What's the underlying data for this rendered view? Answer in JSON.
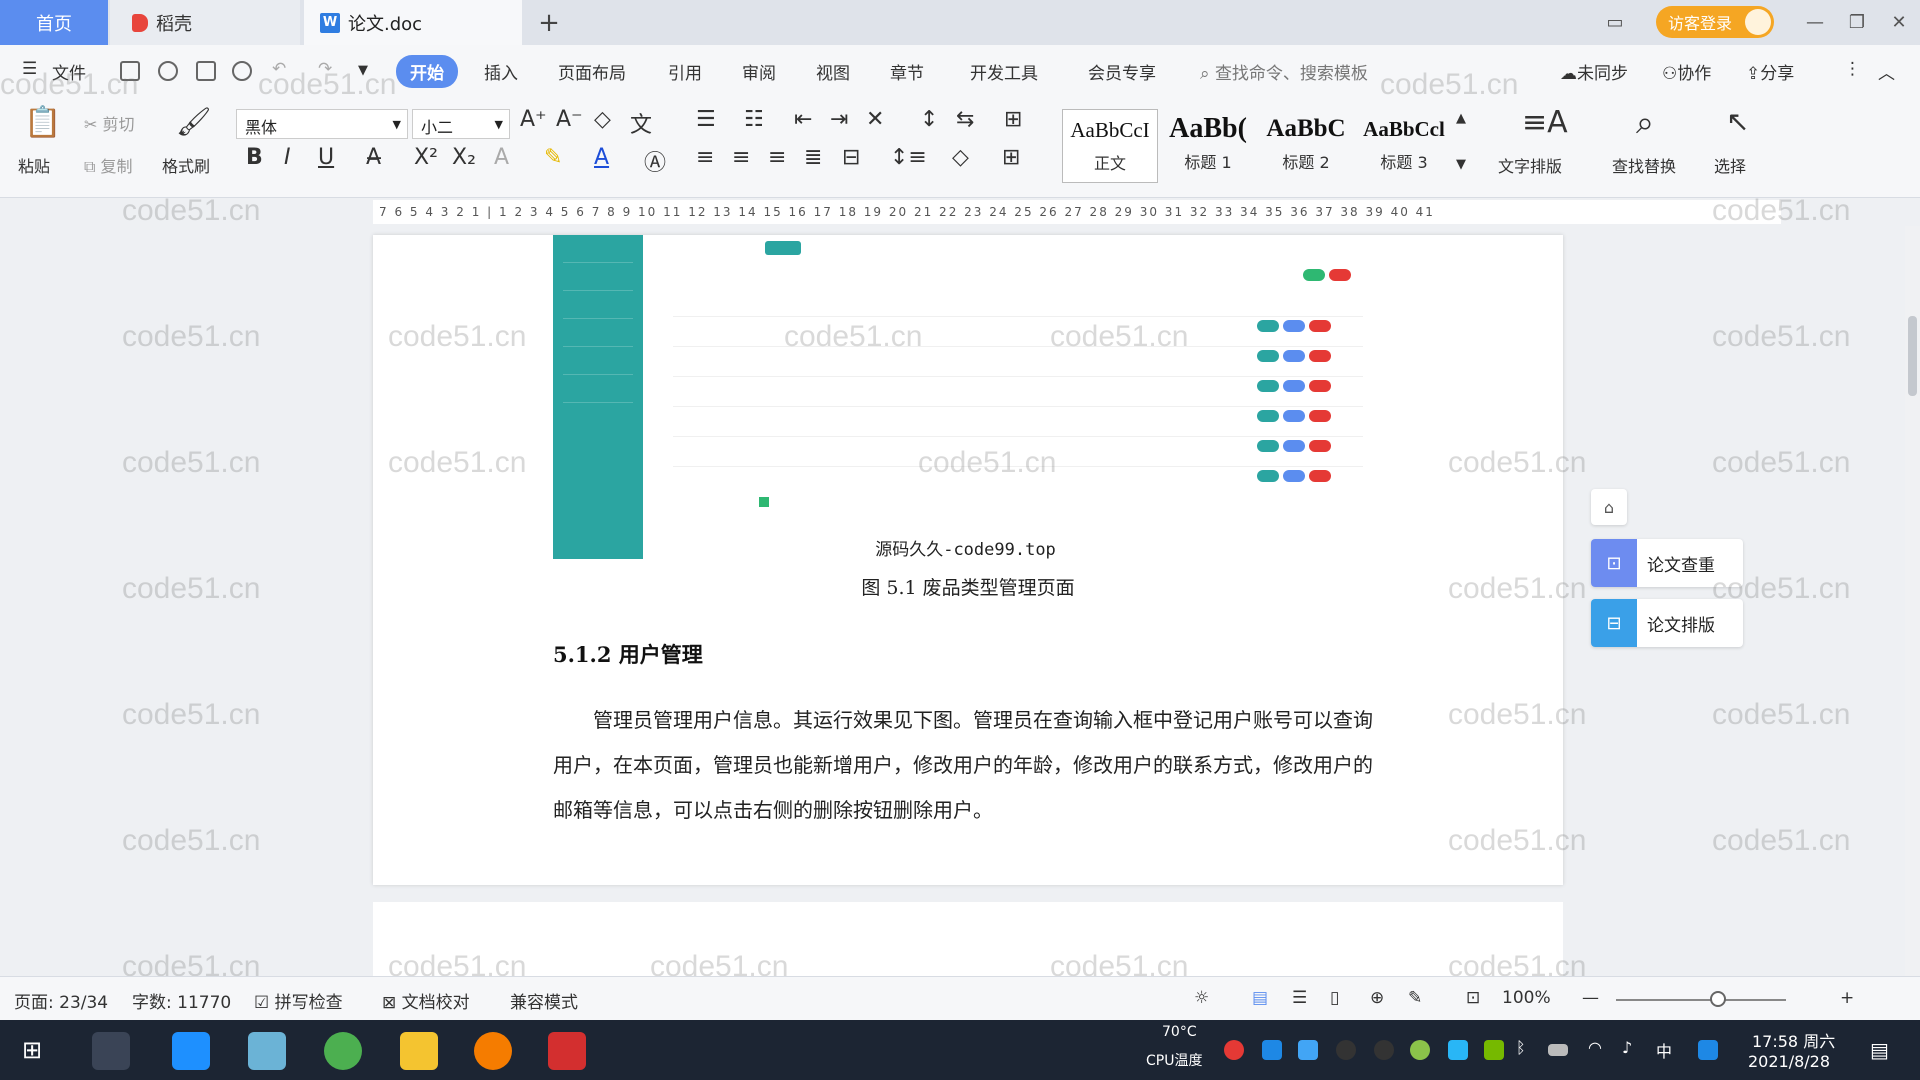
{
  "tabs": {
    "home": "首页",
    "docer": "稻壳",
    "doc": "论文.doc",
    "add": "+"
  },
  "titlebar": {
    "visitor_login": "访客登录"
  },
  "menu": {
    "file": "文件",
    "items": [
      "开始",
      "插入",
      "页面布局",
      "引用",
      "审阅",
      "视图",
      "章节",
      "开发工具",
      "会员专享"
    ],
    "search": "查找命令、搜索模板",
    "unsynced": "未同步",
    "collab": "协作",
    "share": "分享"
  },
  "ribbon": {
    "paste": "粘贴",
    "cut": "剪切",
    "copy": "复制",
    "format_painter": "格式刷",
    "font_name": "黑体",
    "font_size": "小二",
    "styles": [
      {
        "sample": "AaBbCcI",
        "name": "正文"
      },
      {
        "sample": "AaBb(",
        "name": "标题 1"
      },
      {
        "sample": "AaBbC",
        "name": "标题 2"
      },
      {
        "sample": "AaBbCcl",
        "name": "标题 3"
      }
    ],
    "text_layout": "文字排版",
    "find_replace": "查找替换",
    "select": "选择"
  },
  "ruler": {
    "ticks": "7 6 5 4 3 2 1 | 1 2 3 4 5 6 7 8 9 10 11 12 13 14 15 16 17 18 19 20 21 22 23 24 25 26 27 28 29 30 31 32 33 34 35 36 37 38 39 40 41"
  },
  "document": {
    "figure_watermark": "源码久久-code99.top",
    "figure_caption": "图 5.1   废品类型管理页面",
    "section_heading": "5.1.2 用户管理",
    "paragraph": "管理员管理用户信息。其运行效果见下图。管理员在查询输入框中登记用户账号可以查询用户，在本页面，管理员也能新增用户，修改用户的年龄，修改用户的联系方式，修改用户的邮箱等信息，可以点击右侧的删除按钮删除用户。"
  },
  "side_panel": {
    "check": "论文查重",
    "layout": "论文排版"
  },
  "watermark_text": "code51.cn",
  "statusbar": {
    "page": "页面: 23/34",
    "words": "字数: 11770",
    "spell": "拼写检查",
    "proof": "文档校对",
    "compat": "兼容模式",
    "zoom": "100%"
  },
  "taskbar": {
    "cpu_temp": "70°C",
    "cpu_label": "CPU温度",
    "ime": "中",
    "time": "17:58 周六",
    "date": "2021/8/28"
  },
  "colors": {
    "accent": "#5b8def",
    "teal": "#2ba5a1",
    "orange": "#f5a623"
  }
}
